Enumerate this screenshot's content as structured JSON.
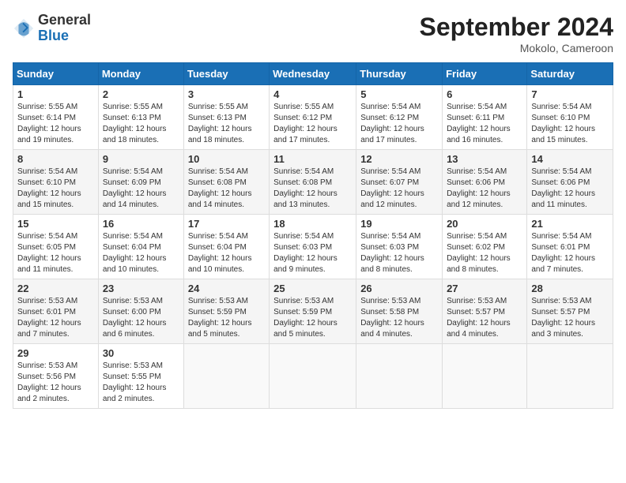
{
  "logo": {
    "general": "General",
    "blue": "Blue"
  },
  "header": {
    "month": "September 2024",
    "location": "Mokolo, Cameroon"
  },
  "weekdays": [
    "Sunday",
    "Monday",
    "Tuesday",
    "Wednesday",
    "Thursday",
    "Friday",
    "Saturday"
  ],
  "weeks": [
    [
      {
        "day": 1,
        "sunrise": "5:55 AM",
        "sunset": "6:14 PM",
        "daylight": "12 hours and 19 minutes."
      },
      {
        "day": 2,
        "sunrise": "5:55 AM",
        "sunset": "6:13 PM",
        "daylight": "12 hours and 18 minutes."
      },
      {
        "day": 3,
        "sunrise": "5:55 AM",
        "sunset": "6:13 PM",
        "daylight": "12 hours and 18 minutes."
      },
      {
        "day": 4,
        "sunrise": "5:55 AM",
        "sunset": "6:12 PM",
        "daylight": "12 hours and 17 minutes."
      },
      {
        "day": 5,
        "sunrise": "5:54 AM",
        "sunset": "6:12 PM",
        "daylight": "12 hours and 17 minutes."
      },
      {
        "day": 6,
        "sunrise": "5:54 AM",
        "sunset": "6:11 PM",
        "daylight": "12 hours and 16 minutes."
      },
      {
        "day": 7,
        "sunrise": "5:54 AM",
        "sunset": "6:10 PM",
        "daylight": "12 hours and 15 minutes."
      }
    ],
    [
      {
        "day": 8,
        "sunrise": "5:54 AM",
        "sunset": "6:10 PM",
        "daylight": "12 hours and 15 minutes."
      },
      {
        "day": 9,
        "sunrise": "5:54 AM",
        "sunset": "6:09 PM",
        "daylight": "12 hours and 14 minutes."
      },
      {
        "day": 10,
        "sunrise": "5:54 AM",
        "sunset": "6:08 PM",
        "daylight": "12 hours and 14 minutes."
      },
      {
        "day": 11,
        "sunrise": "5:54 AM",
        "sunset": "6:08 PM",
        "daylight": "12 hours and 13 minutes."
      },
      {
        "day": 12,
        "sunrise": "5:54 AM",
        "sunset": "6:07 PM",
        "daylight": "12 hours and 12 minutes."
      },
      {
        "day": 13,
        "sunrise": "5:54 AM",
        "sunset": "6:06 PM",
        "daylight": "12 hours and 12 minutes."
      },
      {
        "day": 14,
        "sunrise": "5:54 AM",
        "sunset": "6:06 PM",
        "daylight": "12 hours and 11 minutes."
      }
    ],
    [
      {
        "day": 15,
        "sunrise": "5:54 AM",
        "sunset": "6:05 PM",
        "daylight": "12 hours and 11 minutes."
      },
      {
        "day": 16,
        "sunrise": "5:54 AM",
        "sunset": "6:04 PM",
        "daylight": "12 hours and 10 minutes."
      },
      {
        "day": 17,
        "sunrise": "5:54 AM",
        "sunset": "6:04 PM",
        "daylight": "12 hours and 10 minutes."
      },
      {
        "day": 18,
        "sunrise": "5:54 AM",
        "sunset": "6:03 PM",
        "daylight": "12 hours and 9 minutes."
      },
      {
        "day": 19,
        "sunrise": "5:54 AM",
        "sunset": "6:03 PM",
        "daylight": "12 hours and 8 minutes."
      },
      {
        "day": 20,
        "sunrise": "5:54 AM",
        "sunset": "6:02 PM",
        "daylight": "12 hours and 8 minutes."
      },
      {
        "day": 21,
        "sunrise": "5:54 AM",
        "sunset": "6:01 PM",
        "daylight": "12 hours and 7 minutes."
      }
    ],
    [
      {
        "day": 22,
        "sunrise": "5:53 AM",
        "sunset": "6:01 PM",
        "daylight": "12 hours and 7 minutes."
      },
      {
        "day": 23,
        "sunrise": "5:53 AM",
        "sunset": "6:00 PM",
        "daylight": "12 hours and 6 minutes."
      },
      {
        "day": 24,
        "sunrise": "5:53 AM",
        "sunset": "5:59 PM",
        "daylight": "12 hours and 5 minutes."
      },
      {
        "day": 25,
        "sunrise": "5:53 AM",
        "sunset": "5:59 PM",
        "daylight": "12 hours and 5 minutes."
      },
      {
        "day": 26,
        "sunrise": "5:53 AM",
        "sunset": "5:58 PM",
        "daylight": "12 hours and 4 minutes."
      },
      {
        "day": 27,
        "sunrise": "5:53 AM",
        "sunset": "5:57 PM",
        "daylight": "12 hours and 4 minutes."
      },
      {
        "day": 28,
        "sunrise": "5:53 AM",
        "sunset": "5:57 PM",
        "daylight": "12 hours and 3 minutes."
      }
    ],
    [
      {
        "day": 29,
        "sunrise": "5:53 AM",
        "sunset": "5:56 PM",
        "daylight": "12 hours and 2 minutes."
      },
      {
        "day": 30,
        "sunrise": "5:53 AM",
        "sunset": "5:55 PM",
        "daylight": "12 hours and 2 minutes."
      },
      null,
      null,
      null,
      null,
      null
    ]
  ]
}
